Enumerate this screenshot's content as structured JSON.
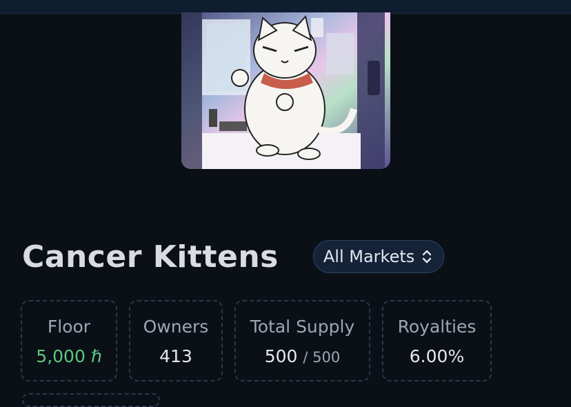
{
  "collection": {
    "name": "Cancer Kittens",
    "market_filter": "All Markets",
    "image_alt": "Cartoon white cat standing in a holographic doorway"
  },
  "stats": [
    {
      "label": "Floor",
      "value": "5,000",
      "unit": "ℏ",
      "color": "#5fc77f"
    },
    {
      "label": "Owners",
      "value": "413"
    },
    {
      "label": "Total Supply",
      "value": "500",
      "sub": "/ 500"
    },
    {
      "label": "Royalties",
      "value": "6.00%"
    }
  ],
  "colors": {
    "background": "#0b1017",
    "accent_green": "#5fc77f",
    "select_bg": "#142338"
  }
}
